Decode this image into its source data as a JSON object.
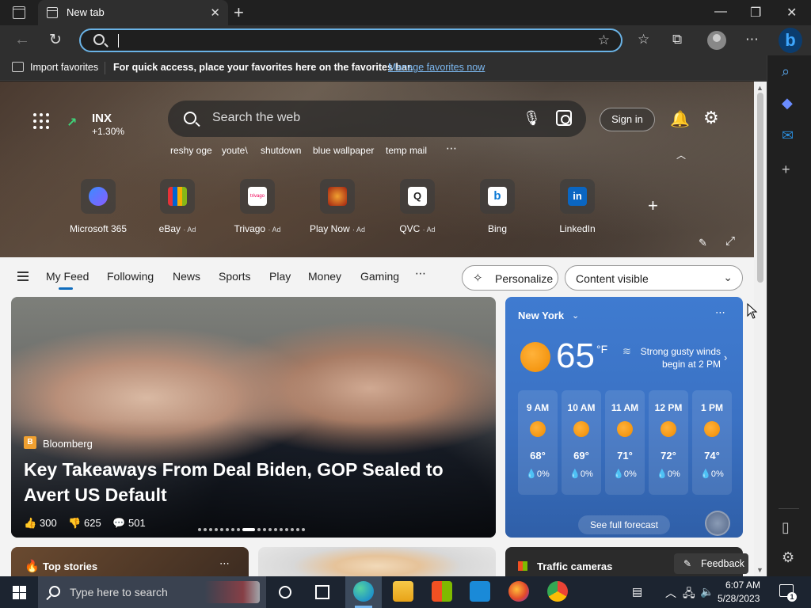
{
  "browser": {
    "tab_title": "New tab",
    "address_value": ""
  },
  "favbar": {
    "import_label": "Import favorites",
    "message": "For quick access, place your favorites here on the favorites bar.",
    "link": "Manage favorites now"
  },
  "hero": {
    "ticker": {
      "name": "INX",
      "change": "+1.30%"
    },
    "search_placeholder": "Search the web",
    "sign_in": "Sign in",
    "trending": [
      "reshy oge",
      "youte\\",
      "shutdown",
      "blue wallpaper",
      "temp mail"
    ],
    "quick_links": [
      {
        "label": "Microsoft 365",
        "ad": ""
      },
      {
        "label": "eBay",
        "ad": "· Ad"
      },
      {
        "label": "Trivago",
        "ad": "· Ad"
      },
      {
        "label": "Play Now",
        "ad": "· Ad"
      },
      {
        "label": "QVC",
        "ad": "· Ad"
      },
      {
        "label": "Bing",
        "ad": ""
      },
      {
        "label": "LinkedIn",
        "ad": ""
      }
    ],
    "trivago_logo_text": "trivago"
  },
  "feednav": {
    "items": [
      "My Feed",
      "Following",
      "News",
      "Sports",
      "Play",
      "Money",
      "Gaming"
    ],
    "personalize": "Personalize",
    "content_select": "Content visible"
  },
  "story": {
    "source": "Bloomberg",
    "source_initial": "B",
    "title": "Key Takeaways From Deal Biden, GOP Sealed to Avert US Default",
    "likes": "300",
    "dislikes": "625",
    "comments": "501"
  },
  "weather": {
    "city": "New York",
    "temp": "65",
    "unit": "°F",
    "alert": "Strong gusty winds begin at 2 PM",
    "hourly": [
      {
        "time": "9 AM",
        "temp": "68°",
        "precip": "0%"
      },
      {
        "time": "10 AM",
        "temp": "69°",
        "precip": "0%"
      },
      {
        "time": "11 AM",
        "temp": "71°",
        "precip": "0%"
      },
      {
        "time": "12 PM",
        "temp": "72°",
        "precip": "0%"
      },
      {
        "time": "1 PM",
        "temp": "74°",
        "precip": "0%"
      }
    ],
    "forecast_button": "See full forecast"
  },
  "cards": {
    "top_stories": "Top stories",
    "traffic": "Traffic cameras",
    "feedback": "Feedback"
  },
  "taskbar": {
    "search_placeholder": "Type here to search",
    "time": "6:07 AM",
    "date": "5/28/2023",
    "notification_count": "1"
  }
}
